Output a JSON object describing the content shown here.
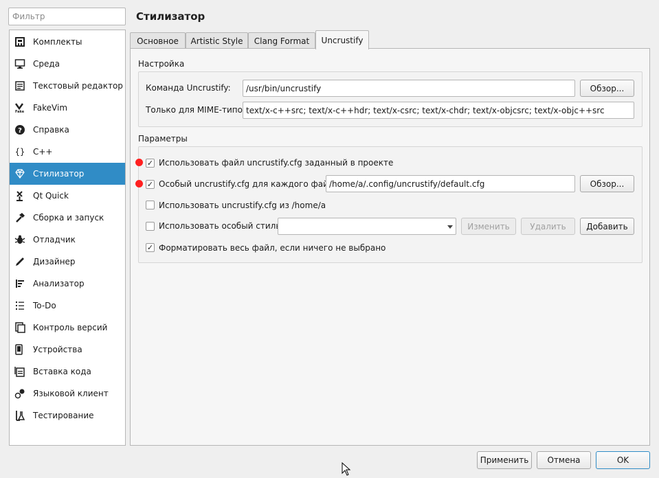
{
  "filter": {
    "placeholder": "Фильтр"
  },
  "sidebar": {
    "items": [
      {
        "label": "Комплекты",
        "icon": "kits-icon"
      },
      {
        "label": "Среда",
        "icon": "monitor-icon"
      },
      {
        "label": "Текстовый редактор",
        "icon": "text-editor-icon"
      },
      {
        "label": "FakeVim",
        "icon": "fakevim-icon"
      },
      {
        "label": "Справка",
        "icon": "help-icon"
      },
      {
        "label": "C++",
        "icon": "cpp-icon"
      },
      {
        "label": "Стилизатор",
        "icon": "beautifier-icon",
        "active": true
      },
      {
        "label": "Qt Quick",
        "icon": "qt-quick-icon"
      },
      {
        "label": "Сборка и запуск",
        "icon": "hammer-icon"
      },
      {
        "label": "Отладчик",
        "icon": "bug-icon"
      },
      {
        "label": "Дизайнер",
        "icon": "pen-icon"
      },
      {
        "label": "Анализатор",
        "icon": "analyzer-icon"
      },
      {
        "label": "To-Do",
        "icon": "list-icon"
      },
      {
        "label": "Контроль версий",
        "icon": "version-control-icon"
      },
      {
        "label": "Устройства",
        "icon": "devices-icon"
      },
      {
        "label": "Вставка кода",
        "icon": "snippet-icon"
      },
      {
        "label": "Языковой клиент",
        "icon": "language-client-icon"
      },
      {
        "label": "Тестирование",
        "icon": "testing-icon"
      }
    ]
  },
  "page": {
    "title": "Стилизатор"
  },
  "tabs": [
    {
      "label": "Основное"
    },
    {
      "label": "Artistic Style"
    },
    {
      "label": "Clang Format"
    },
    {
      "label": "Uncrustify",
      "active": true
    }
  ],
  "settings": {
    "title": "Настройка",
    "command_label": "Команда Uncrustify:",
    "command_value": "/usr/bin/uncrustify",
    "browse_label": "Обзор...",
    "mime_label": "Только для MIME-типов:",
    "mime_value": "text/x-c++src; text/x-c++hdr; text/x-csrc; text/x-chdr; text/x-objcsrc; text/x-objc++src"
  },
  "params": {
    "title": "Параметры",
    "use_project_cfg": {
      "label": "Использовать файл uncrustify.cfg заданный в проекте",
      "checked": true
    },
    "custom_cfg": {
      "label": "Особый uncrustify.cfg для каждого файла",
      "checked": true,
      "value": "/home/a/.config/uncrustify/default.cfg"
    },
    "browse_label": "Обзор...",
    "use_home_cfg": {
      "label": "Использовать uncrustify.cfg из /home/a",
      "checked": false
    },
    "custom_style": {
      "label": "Использовать особый стиль:",
      "checked": false,
      "value": ""
    },
    "edit_label": "Изменить",
    "delete_label": "Удалить",
    "add_label": "Добавить",
    "format_whole": {
      "label": "Форматировать весь файл, если ничего не выбрано",
      "checked": true
    }
  },
  "footer": {
    "apply_label": "Применить",
    "cancel_label": "Отмена",
    "ok_label": "OK"
  },
  "check_glyph": "✓",
  "colors": {
    "accent": "#308cc6",
    "marker": "#ff2020"
  }
}
